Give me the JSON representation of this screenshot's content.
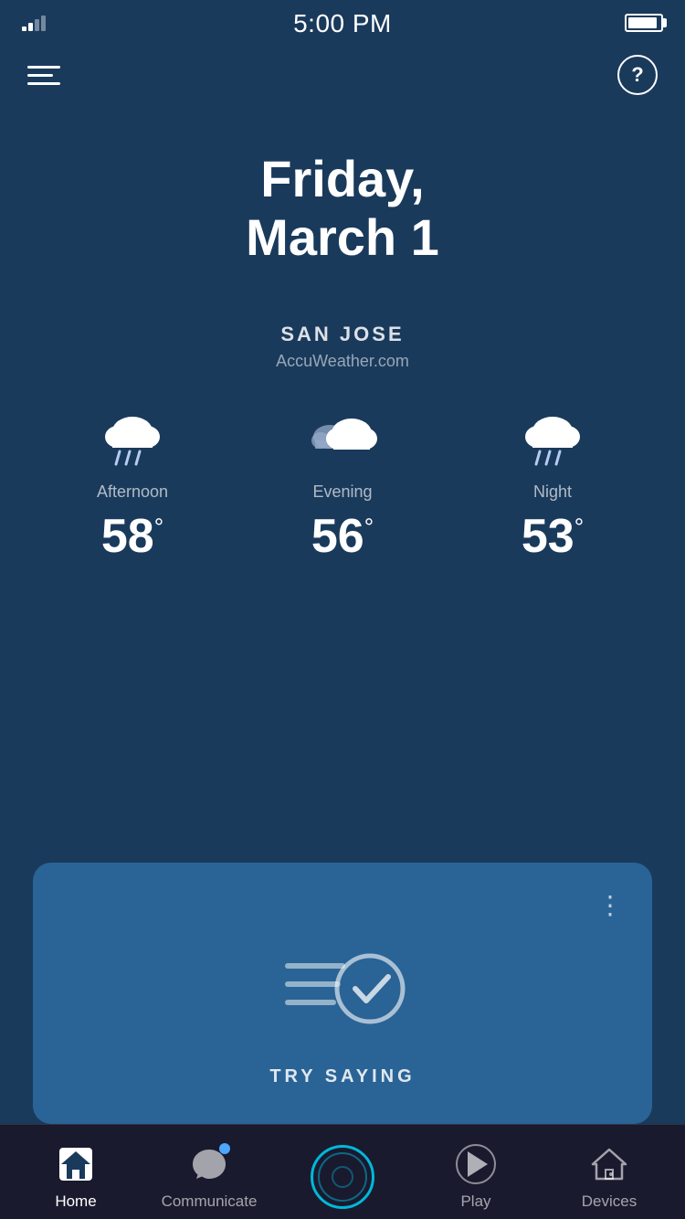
{
  "statusBar": {
    "time": "5:00 PM"
  },
  "header": {
    "helpLabel": "?"
  },
  "date": {
    "line1": "Friday,",
    "line2": "March 1"
  },
  "location": {
    "city": "SAN JOSE",
    "source": "AccuWeather.com"
  },
  "weather": {
    "periods": [
      {
        "label": "Afternoon",
        "temp": "58",
        "degree": "°",
        "icon": "rain-cloud"
      },
      {
        "label": "Evening",
        "temp": "56",
        "degree": "°",
        "icon": "partly-cloudy"
      },
      {
        "label": "Night",
        "temp": "53",
        "degree": "°",
        "icon": "rain-cloud"
      }
    ]
  },
  "trySaying": {
    "label": "TRY SAYING"
  },
  "bottomNav": {
    "items": [
      {
        "id": "home",
        "label": "Home",
        "active": true
      },
      {
        "id": "communicate",
        "label": "Communicate",
        "active": false
      },
      {
        "id": "alexa",
        "label": "",
        "active": false
      },
      {
        "id": "play",
        "label": "Play",
        "active": false
      },
      {
        "id": "devices",
        "label": "Devices",
        "active": false
      }
    ]
  },
  "colors": {
    "bgMain": "#1a3a5c",
    "bgCard": "#2a6496",
    "bgNav": "#1a1a2e",
    "alexaRing": "#00b8d9",
    "notifDot": "#4da6ff"
  }
}
